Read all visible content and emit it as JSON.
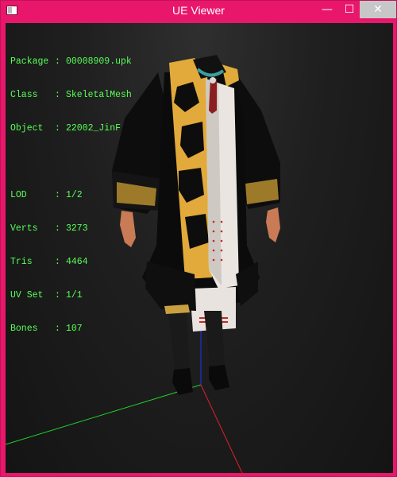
{
  "window": {
    "title": "UE Viewer",
    "minimize_glyph": "—",
    "maximize_glyph": "☐",
    "close_glyph": "✕"
  },
  "info": {
    "package": {
      "label": "Package",
      "value": "00008909.upk"
    },
    "class": {
      "label": "Class",
      "value": "SkeletalMesh"
    },
    "object": {
      "label": "Object",
      "value": "22002_JinF"
    },
    "lod": {
      "label": "LOD",
      "value": "1/2"
    },
    "verts": {
      "label": "Verts",
      "value": "3273"
    },
    "tris": {
      "label": "Tris",
      "value": "4464"
    },
    "uvset": {
      "label": "UV Set",
      "value": "1/1"
    },
    "bones": {
      "label": "Bones",
      "value": "107"
    }
  },
  "colors": {
    "title_bar": "#e8176b",
    "info_text": "#57ff57",
    "axis_x": "#e0202a",
    "axis_y": "#1fd12f",
    "axis_z": "#2030ff"
  }
}
